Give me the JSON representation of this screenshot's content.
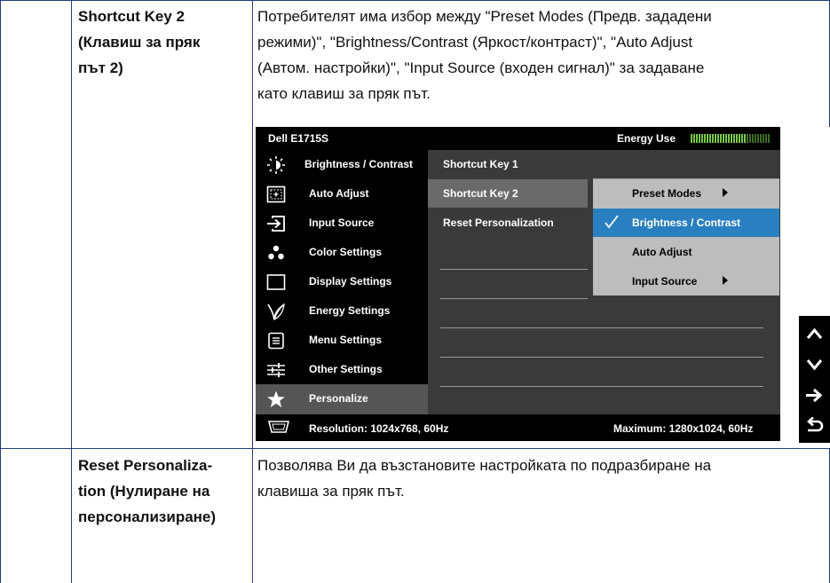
{
  "rows": [
    {
      "title_lines": [
        "Shortcut Key 2",
        "(Клавиш за пряк",
        "път 2)"
      ],
      "desc_lines": [
        "Потребителят има избор между \"Preset Modes (Предв. зададени",
        "режими)\", \"Brightness/Contrast (Яркост/контраст)\", \"Auto Adjust",
        "(Автом. настройки)\", \"Input Source (входен сигнал)\" за задаване",
        "като клавиш за пряк път."
      ]
    },
    {
      "title_lines": [
        "Reset Personaliza-",
        "tion (Нулиране на",
        "персонализиране)"
      ],
      "desc_lines": [
        "Позволява Ви да възстановите настройката по подразбиране на",
        "клавиша за пряк път."
      ]
    }
  ],
  "osd": {
    "model": "Dell E1715S",
    "energy_label": "Energy Use",
    "energy_level": 0.7,
    "energy_color": "#7ac943",
    "menu": [
      {
        "label": "Brightness / Contrast",
        "icon": "brightness-icon"
      },
      {
        "label": "Auto Adjust",
        "icon": "auto-adjust-icon"
      },
      {
        "label": "Input Source",
        "icon": "input-source-icon"
      },
      {
        "label": "Color Settings",
        "icon": "color-settings-icon"
      },
      {
        "label": "Display Settings",
        "icon": "display-settings-icon"
      },
      {
        "label": "Energy Settings",
        "icon": "energy-leaf-icon"
      },
      {
        "label": "Menu Settings",
        "icon": "menu-settings-icon"
      },
      {
        "label": "Other Settings",
        "icon": "sliders-icon"
      },
      {
        "label": "Personalize",
        "icon": "star-icon",
        "active": true
      }
    ],
    "submenu": [
      {
        "label": "Shortcut Key 1"
      },
      {
        "label": "Shortcut Key 2",
        "selected": true
      },
      {
        "label": "Reset Personalization"
      }
    ],
    "options": [
      {
        "label": "Preset Modes",
        "has_arrow": true
      },
      {
        "label": "Brightness / Contrast",
        "checked": true,
        "selected": true
      },
      {
        "label": "Auto Adjust"
      },
      {
        "label": "Input Source",
        "has_arrow": true
      }
    ],
    "selection_color": "#2a7fc0",
    "resolution": "Resolution: 1024x768, 60Hz",
    "maximum": "Maximum: 1280x1024, 60Hz"
  },
  "nav_buttons": [
    {
      "icon": "up-arrow-icon"
    },
    {
      "icon": "down-arrow-icon"
    },
    {
      "icon": "right-arrow-icon"
    },
    {
      "icon": "back-arrow-icon"
    }
  ]
}
